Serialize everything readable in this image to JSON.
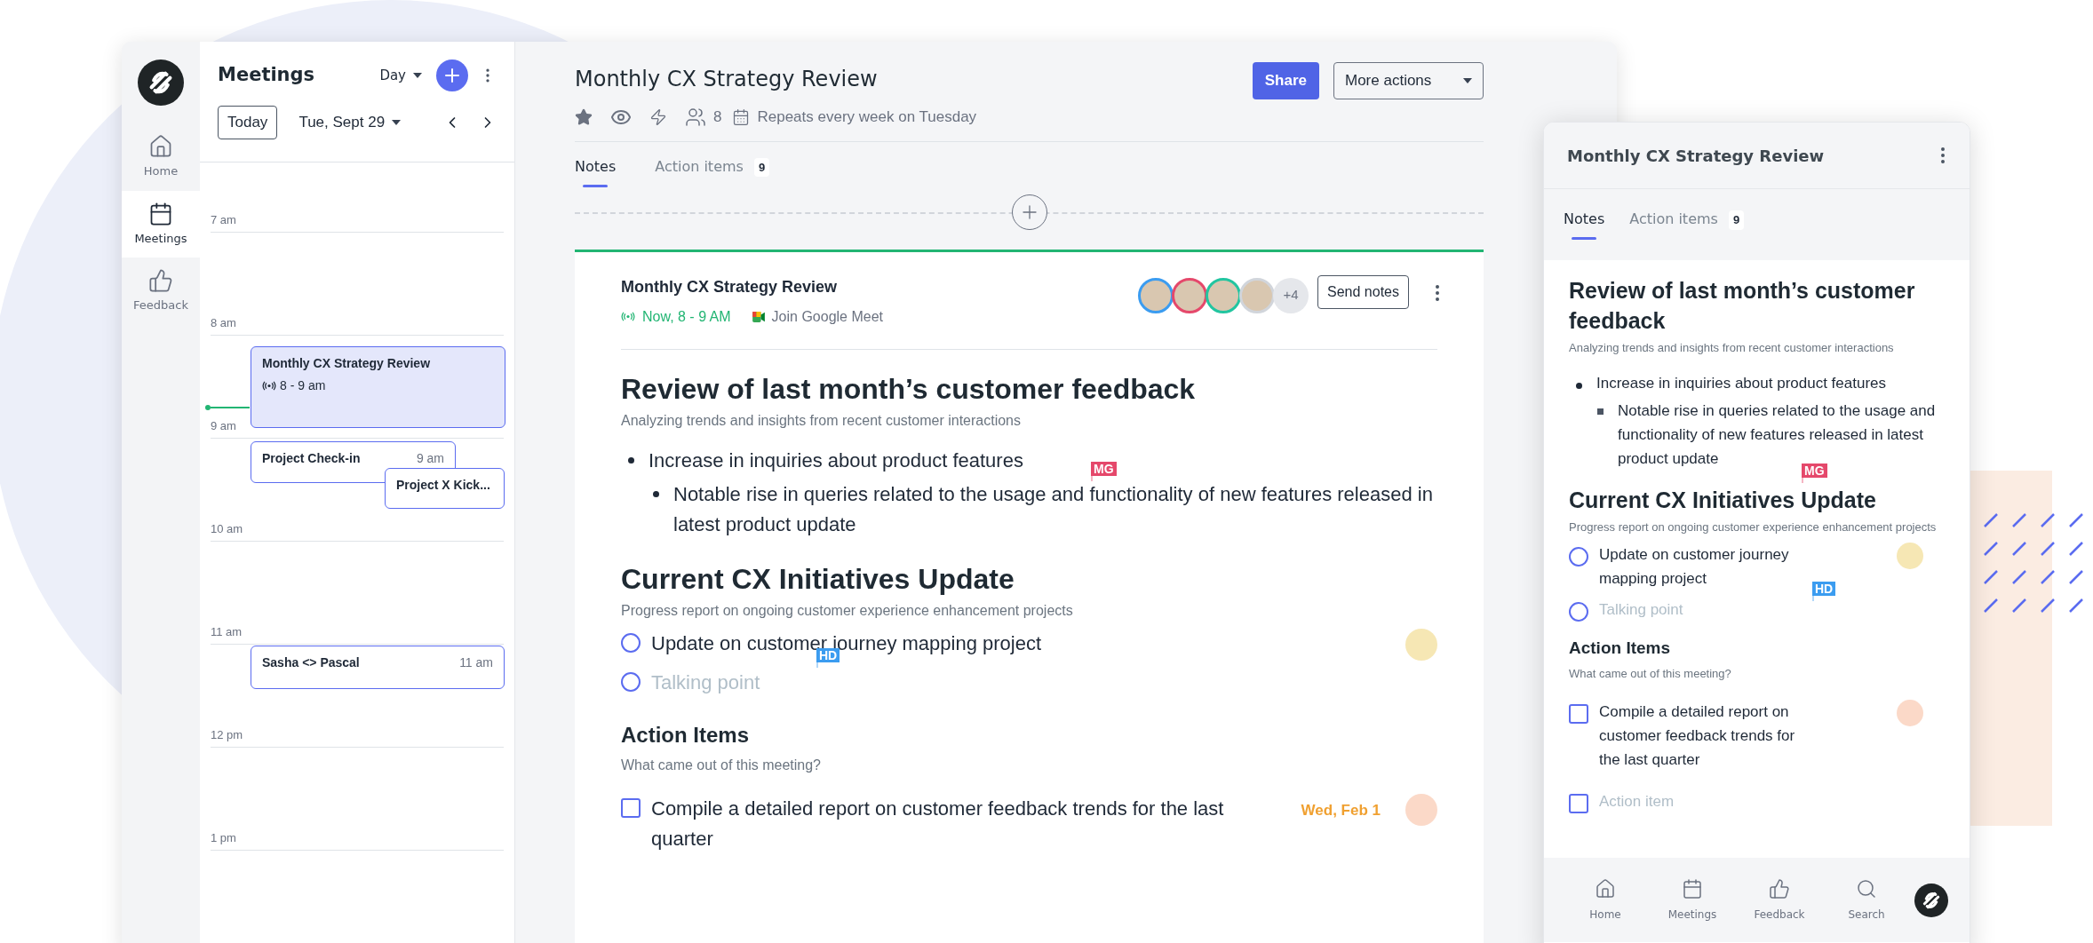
{
  "nav_rail": {
    "items": [
      {
        "kind": "home",
        "label": "Home",
        "selected": false
      },
      {
        "kind": "meetings",
        "label": "Meetings",
        "selected": true
      },
      {
        "kind": "feedback",
        "label": "Feedback",
        "selected": false
      }
    ]
  },
  "calendar": {
    "title": "Meetings",
    "view": "Day",
    "today_button": "Today",
    "date": "Tue, Sept 29",
    "hours": [
      "7 am",
      "8 am",
      "9 am",
      "10 am",
      "11 am",
      "12 pm",
      "1 pm"
    ],
    "events": [
      {
        "title": "Monthly CX Strategy Review",
        "time": "8 - 9 am",
        "live": true,
        "selected": true
      },
      {
        "title": "Project Check-in",
        "time": "9 am",
        "live": false,
        "selected": false
      },
      {
        "title": "Project X Kick...",
        "live": false,
        "selected": false
      },
      {
        "title": "Sasha <> Pascal",
        "time": "11 am",
        "live": false,
        "selected": false
      }
    ]
  },
  "meeting": {
    "title": "Monthly CX Strategy Review",
    "attendee_count": "8",
    "recurrence": "Repeats every week on Tuesday",
    "buttons": {
      "share": "Share",
      "more_actions": "More actions"
    },
    "tabs": [
      {
        "label": "Notes",
        "selected": true
      },
      {
        "label": "Action items",
        "count": "9",
        "selected": false
      }
    ],
    "card": {
      "title": "Monthly CX Strategy Review",
      "status": "Now, 8 - 9 AM",
      "meet_link": "Join Google Meet",
      "attendees": [
        {
          "color": "#3b9cf0"
        },
        {
          "color": "#e5486b"
        },
        {
          "color": "#22c5a0"
        },
        {
          "color": "#d1d5db"
        }
      ],
      "more_attendees": "+4",
      "send_notes": "Send notes",
      "blocks": [
        {
          "kind": "heading",
          "text": "Review of last month’s customer feedback"
        },
        {
          "kind": "subtitle",
          "text": "Analyzing trends and insights from recent customer interactions"
        },
        {
          "kind": "bullet",
          "text": "Increase in inquiries about product features",
          "children": [
            {
              "kind": "bullet",
              "text": "Notable rise in queries related to the usage and functionality of new features released in latest product update",
              "cursor": {
                "label": "MG",
                "color": "#e5486b"
              }
            }
          ]
        },
        {
          "kind": "heading",
          "text": "Current CX Initiatives Update"
        },
        {
          "kind": "subtitle",
          "text": "Progress report on ongoing customer experience enhancement projects"
        },
        {
          "kind": "talking_point",
          "text": "Update on customer journey mapping project",
          "placeholder": false,
          "assignee": {
            "color": "#f6e7b4"
          }
        },
        {
          "kind": "talking_point",
          "text": "Talking point",
          "placeholder": true,
          "cursor": {
            "label": "HD",
            "color": "#3b9cf0"
          }
        },
        {
          "kind": "section",
          "text": "Action Items"
        },
        {
          "kind": "subtitle",
          "text": "What came out of this meeting?"
        },
        {
          "kind": "action_item",
          "text": "Compile a detailed report on customer feedback trends for the last quarter",
          "checked": false,
          "placeholder": false,
          "due": "Wed, Feb 1",
          "assignee": {
            "color": "#fbd9c8"
          }
        }
      ]
    }
  },
  "mobile": {
    "title": "Monthly CX Strategy Review",
    "tabs": [
      {
        "label": "Notes",
        "selected": true
      },
      {
        "label": "Action items",
        "count": "9",
        "selected": false
      }
    ],
    "blocks": [
      {
        "kind": "heading",
        "text": "Review of last month’s customer feedback"
      },
      {
        "kind": "subtitle",
        "text": "Analyzing trends and insights from recent customer interactions"
      },
      {
        "kind": "bullet",
        "text": "Increase in inquiries about product features",
        "children": [
          {
            "kind": "bullet",
            "text": "Notable rise in queries related to the usage and functionality of new features released in latest product update"
          }
        ]
      },
      {
        "kind": "heading",
        "text": "Current CX Initiatives Update",
        "cursor": {
          "label": "MG",
          "color": "#e5486b"
        }
      },
      {
        "kind": "subtitle",
        "text": "Progress report on ongoing customer experience enhancement projects"
      },
      {
        "kind": "talking_point",
        "text": "Update on customer journey mapping project",
        "placeholder": false,
        "assignee": {
          "color": "#f6e7b4"
        }
      },
      {
        "kind": "talking_point",
        "text": "Talking point",
        "placeholder": true,
        "cursor": {
          "label": "HD",
          "color": "#3b9cf0"
        }
      },
      {
        "kind": "section",
        "text": "Action Items"
      },
      {
        "kind": "subtitle",
        "text": "What came out of this meeting?"
      },
      {
        "kind": "action_item",
        "text": "Compile a detailed report on customer feedback trends for the last quarter",
        "checked": false,
        "placeholder": false,
        "assignee": {
          "color": "#fbd9c8"
        }
      },
      {
        "kind": "action_item",
        "text": "Action item",
        "checked": false,
        "placeholder": true
      }
    ],
    "bottom_nav": [
      {
        "kind": "home",
        "label": "Home"
      },
      {
        "kind": "meetings",
        "label": "Meetings"
      },
      {
        "kind": "feedback",
        "label": "Feedback"
      },
      {
        "kind": "search",
        "label": "Search"
      }
    ]
  }
}
